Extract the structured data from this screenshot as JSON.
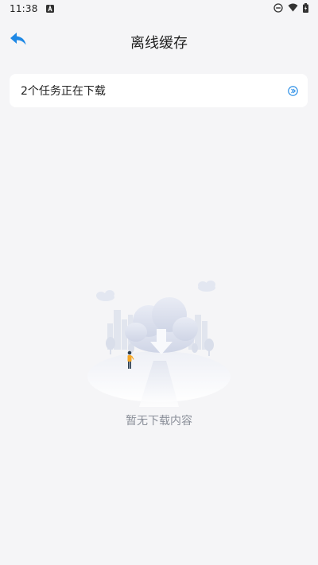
{
  "status_bar": {
    "time": "11:38",
    "icons": [
      "notification-a-icon",
      "do-not-disturb-icon",
      "wifi-icon",
      "battery-icon"
    ]
  },
  "header": {
    "title": "离线缓存",
    "back_icon": "back-arrow-icon"
  },
  "task_card": {
    "label": "2个任务正在下载",
    "arrow_icon": "chevron-right-circle-icon"
  },
  "empty_state": {
    "illustration": "cloud-download-illustration",
    "message": "暂无下载内容"
  },
  "colors": {
    "background": "#f5f5f7",
    "accent": "#2196f3",
    "card": "#ffffff",
    "muted_text": "#8a8f99"
  }
}
